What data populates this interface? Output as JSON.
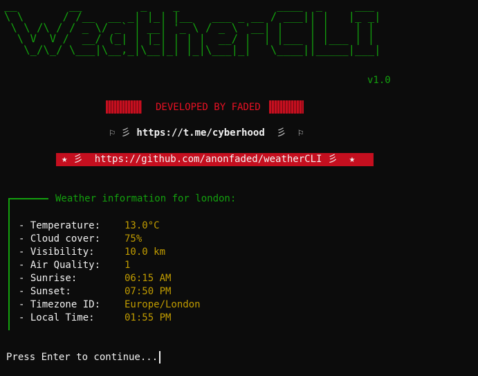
{
  "banner": {
    "ascii_art": "__        __         _    _               ____  _     ___\n\\ \\      / /__  __ _| |_| |__   ___ _ __ / ___|| |   |_ _|\n \\ \\ /\\ / / _ \\/ _` | __| '_ \\ / _ \\ '__| |    | |    | |\n  \\ V  V /  __/ (_| | |_| | | |  __/ |  | |___ | |___ | |\n   \\_/\\_/ \\___|\\__,_|\\__|_| |_|\\___|_|   \\____||_____|___|",
    "version": "v1.0"
  },
  "developer": {
    "text": "DEVELOPED BY FADED",
    "deco_left": "▀▄·",
    "deco_right": "·▄▀"
  },
  "telegram": {
    "flag": "⚐",
    "wave": "彡",
    "link": "https://t.me/cyberhood"
  },
  "github": {
    "star": "★",
    "wave": "彡",
    "link": "https://github.com/anonfaded/weatherCLI"
  },
  "weather": {
    "title": "Weather information for london:",
    "rows": [
      {
        "label": "- Temperature:",
        "value": "13.0°C"
      },
      {
        "label": "- Cloud cover:",
        "value": "75%"
      },
      {
        "label": "- Visibility:",
        "value": "10.0 km"
      },
      {
        "label": "- Air Quality:",
        "value": "1"
      },
      {
        "label": "- Sunrise:",
        "value": "06:15 AM"
      },
      {
        "label": "- Sunset:",
        "value": "07:50 PM"
      },
      {
        "label": "- Timezone ID:",
        "value": "Europe/London"
      },
      {
        "label": "- Local Time:",
        "value": "01:55 PM"
      }
    ]
  },
  "prompt": {
    "text": "Press Enter to continue..."
  },
  "colors": {
    "background": "#0c0c0c",
    "green": "#13a10e",
    "red": "#c50f1f",
    "yellow": "#c19c00",
    "white": "#f2f2f2"
  }
}
